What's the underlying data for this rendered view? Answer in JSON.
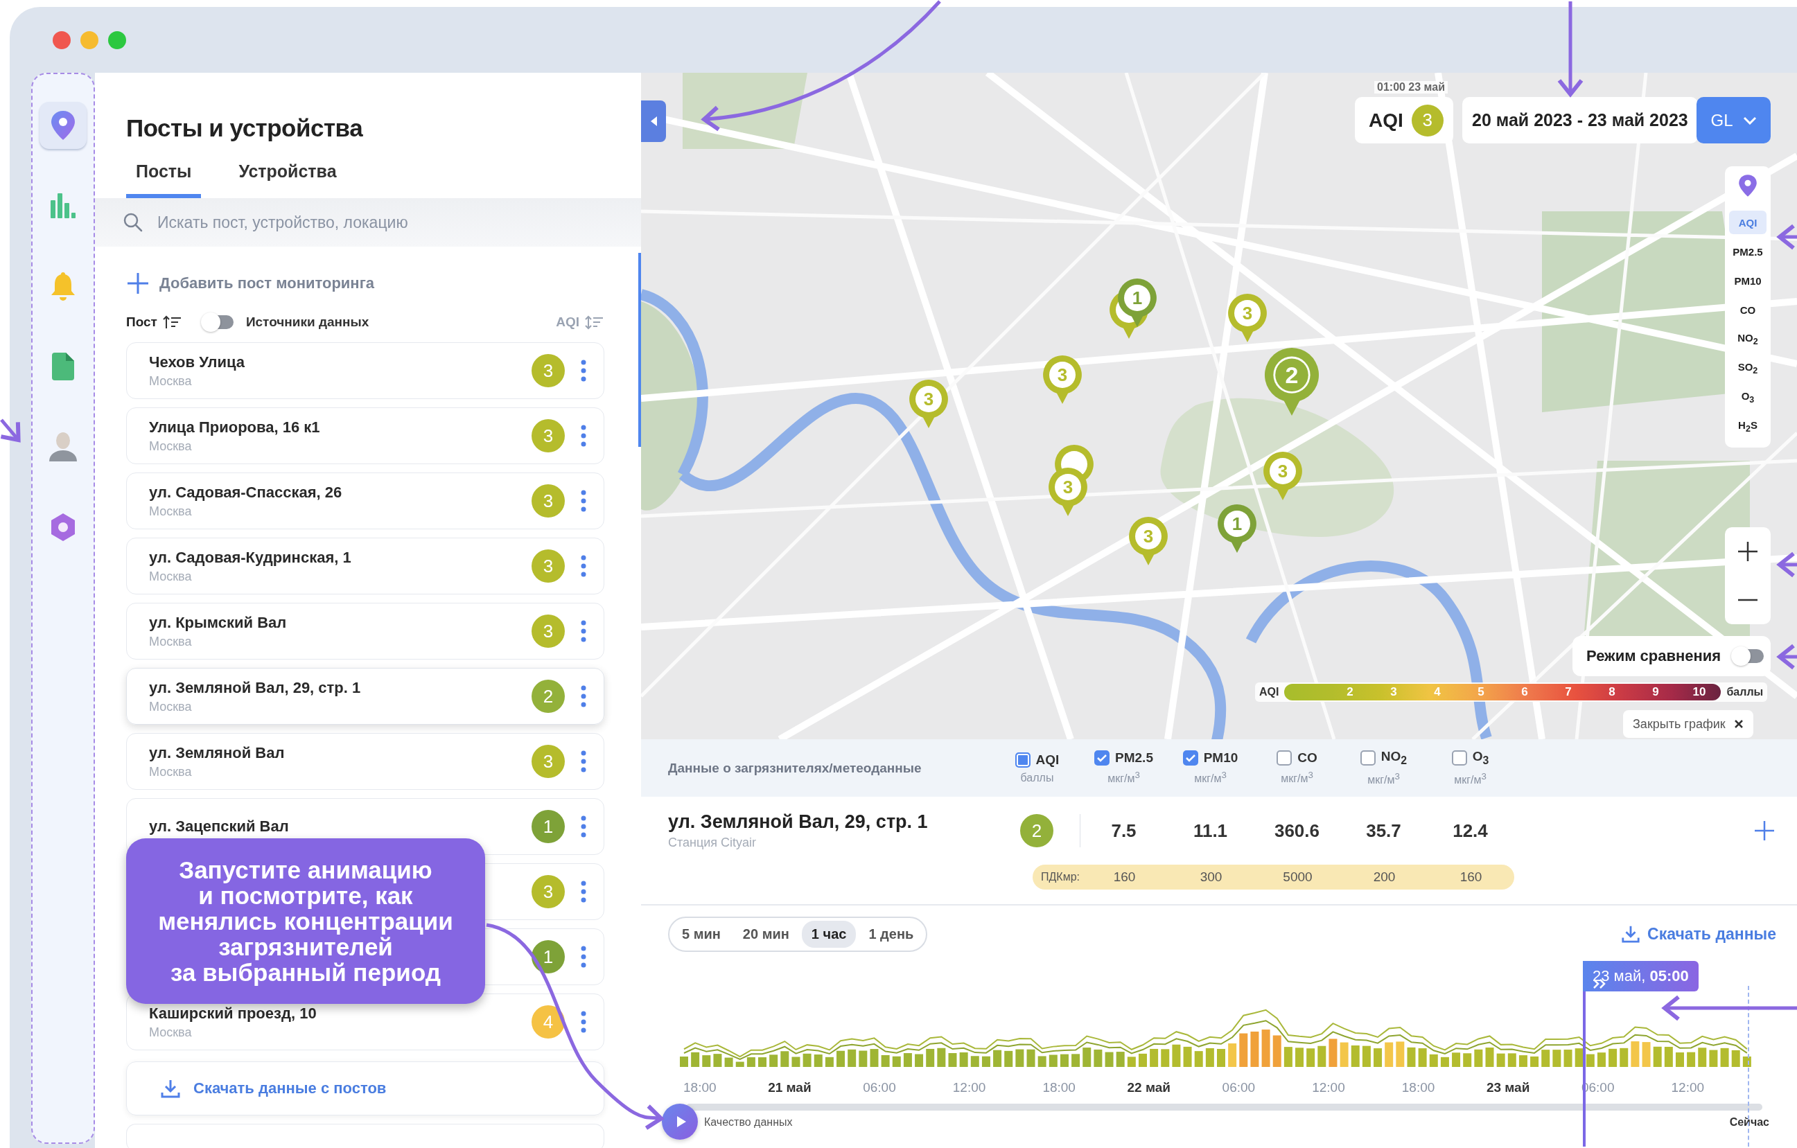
{
  "nav": [
    {
      "kind": "pin",
      "selected": true
    },
    {
      "kind": "chart",
      "selected": false
    },
    {
      "kind": "bell",
      "selected": false
    },
    {
      "kind": "document",
      "selected": false
    },
    {
      "kind": "person",
      "selected": false
    },
    {
      "kind": "hexagon",
      "selected": false
    }
  ],
  "panel": {
    "title": "Посты и устройства",
    "tabs": [
      {
        "label": "Посты",
        "selected": true
      },
      {
        "label": "Устройства",
        "selected": false
      }
    ],
    "search": {
      "placeholder": "Искать пост, устройство, локацию"
    },
    "add_button": "Добавить пост мониторинга",
    "list_header": {
      "post": "Пост",
      "sources_toggle": {
        "label": "Источники данных",
        "on": false
      },
      "aqi": "AQI"
    },
    "posts": [
      {
        "name": "Чехов Улица",
        "city": "Москва",
        "aqi": "3",
        "color": "#b5bc2c",
        "selected": false
      },
      {
        "name": "Улица Приорова, 16 к1",
        "city": "Москва",
        "aqi": "3",
        "color": "#b5bc2c",
        "selected": false
      },
      {
        "name": "ул. Садовая-Спасская, 26",
        "city": "Москва",
        "aqi": "3",
        "color": "#b5bc2c",
        "selected": false
      },
      {
        "name": "ул. Садовая-Кудринская, 1",
        "city": "Москва",
        "aqi": "3",
        "color": "#b5bc2c",
        "selected": false
      },
      {
        "name": "ул. Крымский Вал",
        "city": "Москва",
        "aqi": "3",
        "color": "#b5bc2c",
        "selected": false
      },
      {
        "name": "ул. Земляной Вал, 29, стр. 1",
        "city": "Москва",
        "aqi": "2",
        "color": "#93b13a",
        "selected": true
      },
      {
        "name": "ул. Земляной Вал",
        "city": "Москва",
        "aqi": "3",
        "color": "#b5bc2c",
        "selected": false
      },
      {
        "name": "ул. Зацепский Вал",
        "aqi": "1",
        "color": "#7ea238",
        "selected": false
      },
      {
        "aqi": "3",
        "color": "#b5bc2c",
        "selected": false
      },
      {
        "aqi": "1",
        "color": "#7ea238",
        "selected": false
      },
      {
        "name": "Каширский проезд, 10",
        "city": "Москва",
        "aqi": "4",
        "color": "#f5c244",
        "selected": false
      }
    ],
    "download_button": "Скачать данные с постов"
  },
  "tutorial": {
    "text": "Запустите анимацию\nи посмотрите, как\nменялись концентрации\nзагрязнителей\nза выбранный период"
  },
  "map": {
    "time": "01:00 23 май",
    "aqi_label": "AQI",
    "aqi_value": "3",
    "date_range": "20 май 2023 - 23 май 2023",
    "style_button": "GL",
    "layers": [
      {
        "label": "AQI",
        "selected": true
      },
      {
        "label": "PM2.5",
        "selected": false
      },
      {
        "label": "PM10",
        "selected": false
      },
      {
        "label": "CO",
        "selected": false
      },
      {
        "label": "NO$_{2}$",
        "selected": false
      },
      {
        "label": "SO$_{2}$",
        "selected": false
      },
      {
        "label": "O$_{3}$",
        "selected": false
      },
      {
        "label": "H$_{2}$S",
        "selected": false
      }
    ],
    "compare": {
      "label": "Режим сравнения",
      "on": false
    },
    "scale": {
      "label": "AQI",
      "ticks": [
        "2",
        "3",
        "4",
        "5",
        "6",
        "7",
        "8",
        "9",
        "10"
      ],
      "unit": "баллы"
    },
    "close_chart": "Закрыть график",
    "markers": [
      {
        "number": "1",
        "color": "#7ea238",
        "kind": "stacked",
        "behind": {
          "color": "#b5bc2c"
        }
      },
      {
        "number": "3",
        "color": "#b5bc2c"
      },
      {
        "number": "2",
        "color": "#93b13a"
      },
      {
        "number": "3",
        "color": "#b5bc2c"
      },
      {
        "number": "3",
        "color": "#b5bc2c"
      },
      {
        "number": "3",
        "color": "#b5bc2c",
        "kind": "stacked",
        "behind": {
          "color": "#b5bc2c"
        }
      },
      {
        "number": "3",
        "color": "#b5bc2c"
      },
      {
        "number": "1",
        "color": "#7ea238"
      },
      {
        "number": "3",
        "color": "#b5bc2c"
      }
    ]
  },
  "data": {
    "title": "Данные о загрязнителях/метеоданные",
    "columns": [
      {
        "label": "AQI",
        "unit": "баллы",
        "checked": true
      },
      {
        "label": "PM2.5",
        "unit": "мкг/м$^{3}$",
        "checked": true
      },
      {
        "label": "PM10",
        "unit": "мкг/м$^{3}$",
        "checked": true
      },
      {
        "label": "CO",
        "unit": "мкг/м$^{3}$",
        "checked": false
      },
      {
        "label": "NO$_{2}$",
        "unit": "мкг/м$^{3}$",
        "checked": false
      },
      {
        "label": "O$_{3}$",
        "unit": "мкг/м$^{3}$",
        "checked": false
      }
    ],
    "station": {
      "name": "ул. Земляной Вал, 29, стр. 1",
      "subtitle": "Станция Cityair",
      "aqi": "2",
      "color": "#93b13a",
      "values": [
        "7.5",
        "11.1",
        "360.6",
        "35.7",
        "12.4"
      ]
    },
    "limits": {
      "label": "ПДКмр:",
      "values": [
        "160",
        "300",
        "5000",
        "200",
        "160"
      ]
    }
  },
  "chart": {
    "intervals": [
      {
        "label": "5 мин",
        "selected": false
      },
      {
        "label": "20 мин",
        "selected": false
      },
      {
        "label": "1 час",
        "selected": true
      },
      {
        "label": "1 день",
        "selected": false
      }
    ],
    "download": "Скачать данные",
    "cursor": "23 май, **05:00**",
    "ticks": [
      {
        "label": "18:00",
        "kind": "time"
      },
      {
        "label": "21 май",
        "kind": "date"
      },
      {
        "label": "06:00",
        "kind": "time"
      },
      {
        "label": "12:00",
        "kind": "time"
      },
      {
        "label": "18:00",
        "kind": "time"
      },
      {
        "label": "22 май",
        "kind": "date"
      },
      {
        "label": "06:00",
        "kind": "time"
      },
      {
        "label": "12:00",
        "kind": "time"
      },
      {
        "label": "18:00",
        "kind": "time"
      },
      {
        "label": "23 май",
        "kind": "date"
      },
      {
        "label": "06:00",
        "kind": "time"
      },
      {
        "label": "12:00",
        "kind": "time"
      }
    ],
    "quality_label": "Качество данных",
    "now_label": "Сейчас"
  }
}
